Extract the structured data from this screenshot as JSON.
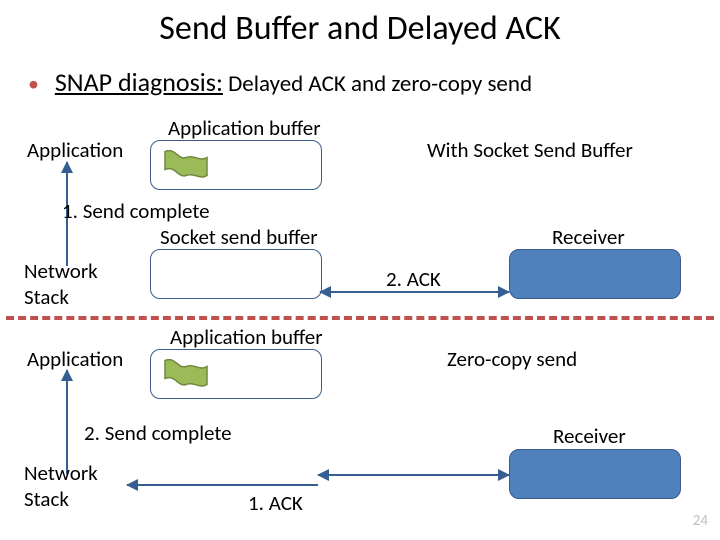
{
  "title": "Send Buffer and Delayed ACK",
  "bullet": {
    "lead": "SNAP diagnosis:",
    "rest": " Delayed ACK and zero-copy send"
  },
  "labels": {
    "app1": "Application",
    "appbuf1": "Application buffer",
    "withsock": "With Socket Send Buffer",
    "sendcomplete1": "1. Send complete",
    "sockbuf": "Socket send buffer",
    "recv1": "Receiver",
    "netstack1": "Network\nStack",
    "ack2": "2. ACK",
    "app2": "Application",
    "appbuf2": "Application buffer",
    "zerocopy": "Zero-copy send",
    "sendcomplete2": "2. Send complete",
    "netstack2": "Network\nStack",
    "ack1": "1. ACK",
    "recv2": "Receiver"
  },
  "colors": {
    "accent_red": "#c0504d",
    "accent_blue": "#4f81bd",
    "arrow": "#365f91"
  },
  "page": "24"
}
